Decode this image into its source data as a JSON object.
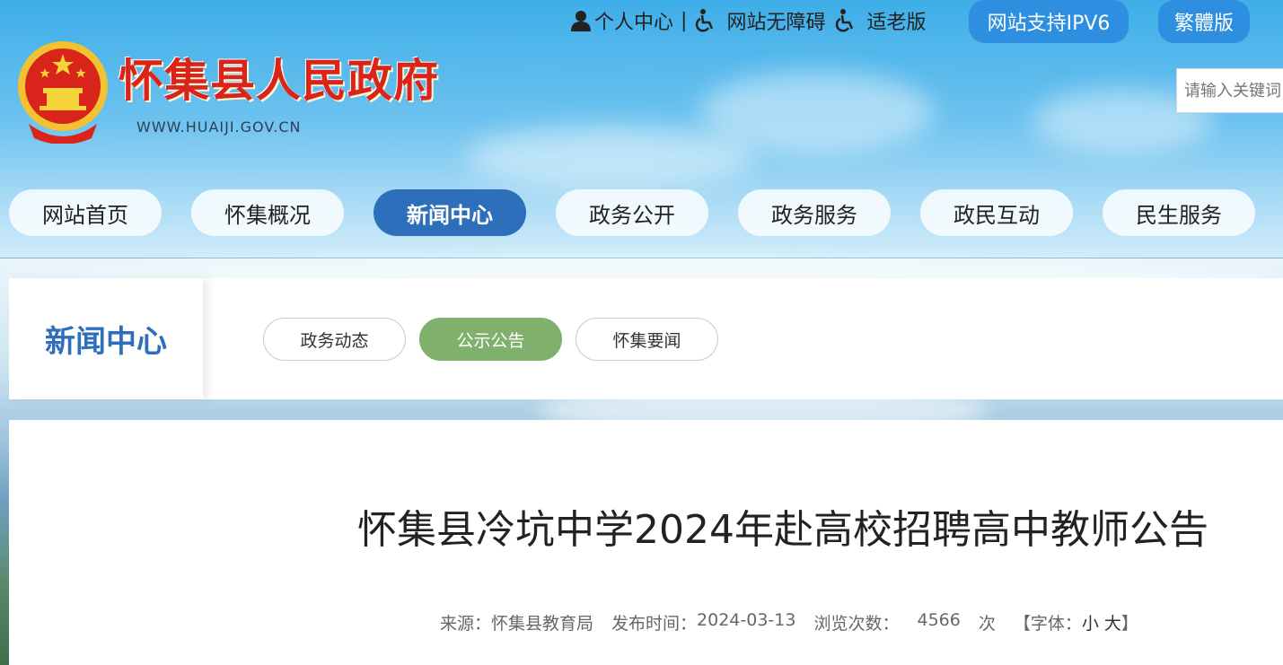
{
  "header": {
    "site_title": "怀集县人民政府",
    "site_url": "WWW.HUAIJI.GOV.CN",
    "emblem_icon": "national-emblem-icon"
  },
  "toplinks": {
    "personal_center": "个人中心",
    "separator": "|",
    "accessibility": "网站无障碍",
    "elder_mode": "适老版",
    "ipv6": "网站支持IPV6",
    "traditional": "繁體版"
  },
  "search": {
    "placeholder": "请输入关键词"
  },
  "nav": {
    "items": [
      {
        "label": "网站首页"
      },
      {
        "label": "怀集概况"
      },
      {
        "label": "新闻中心",
        "active": true
      },
      {
        "label": "政务公开"
      },
      {
        "label": "政务服务"
      },
      {
        "label": "政民互动"
      },
      {
        "label": "民生服务"
      }
    ]
  },
  "section": {
    "title": "新闻中心",
    "tabs": [
      {
        "label": "政务动态"
      },
      {
        "label": "公示公告",
        "active": true
      },
      {
        "label": "怀集要闻"
      }
    ]
  },
  "article": {
    "title": "怀集县冷坑中学2024年赴高校招聘高中教师公告",
    "source_label": "来源：",
    "source": "怀集县教育局",
    "date_label": "发布时间：",
    "date": "2024-03-13",
    "views_label": "浏览次数：",
    "views": "4566",
    "views_unit": "次",
    "font_label": "【字体：",
    "font_small": "小",
    "font_large": "大",
    "font_close": "】"
  },
  "colors": {
    "primary": "#2e6fbb",
    "accent_green": "#7fb06c",
    "title_red": "#d9241c",
    "pill_blue": "#2e8fe0"
  }
}
